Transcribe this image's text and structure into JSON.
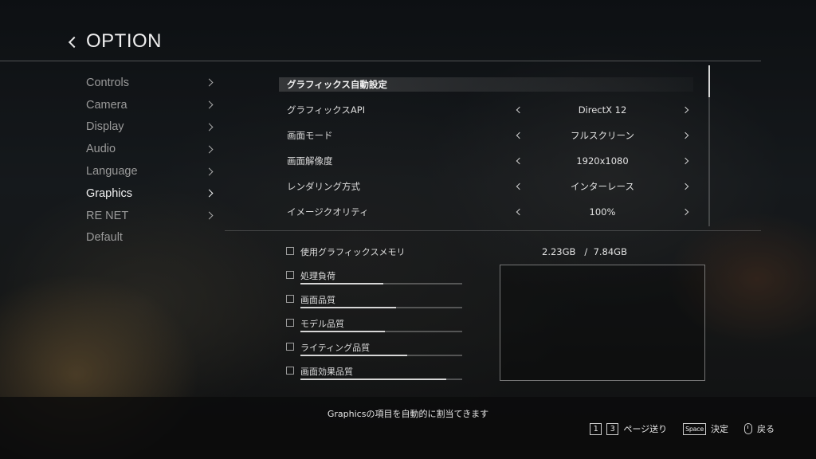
{
  "header": {
    "title": "OPTION"
  },
  "sidebar": {
    "items": [
      {
        "label": "Controls"
      },
      {
        "label": "Camera"
      },
      {
        "label": "Display"
      },
      {
        "label": "Audio"
      },
      {
        "label": "Language"
      },
      {
        "label": "Graphics",
        "active": true
      },
      {
        "label": "RE NET"
      },
      {
        "label": "Default"
      }
    ]
  },
  "settings": {
    "auto": {
      "label": "グラフィックス自動設定"
    },
    "rows": [
      {
        "label": "グラフィックスAPI",
        "value": "DirectX 12"
      },
      {
        "label": "画面モード",
        "value": "フルスクリーン"
      },
      {
        "label": "画面解像度",
        "value": "1920x1080"
      },
      {
        "label": "レンダリング方式",
        "value": "インターレース"
      },
      {
        "label": "イメージクオリティ",
        "value": "100%"
      }
    ]
  },
  "memory": {
    "label": "使用グラフィックスメモリ",
    "used": "2.23GB",
    "separator": "/",
    "total": "7.84GB",
    "items": [
      {
        "label": "処理負荷",
        "level": 0.51
      },
      {
        "label": "画面品質",
        "level": 0.59
      },
      {
        "label": "モデル品質",
        "level": 0.52
      },
      {
        "label": "ライティング品質",
        "level": 0.66
      },
      {
        "label": "画面効果品質",
        "level": 0.9
      }
    ]
  },
  "footer": {
    "hint": "Graphicsの項目を自動的に割当てきます",
    "key1": "1",
    "key3": "3",
    "page_label": "ページ送り",
    "space_key": "Space",
    "confirm_label": "決定",
    "back_label": "戻る"
  },
  "colors": {
    "text_active": "#f2f2f2",
    "text_inactive": "#9a9a9a",
    "bar_fill": "#d6d6d6"
  }
}
